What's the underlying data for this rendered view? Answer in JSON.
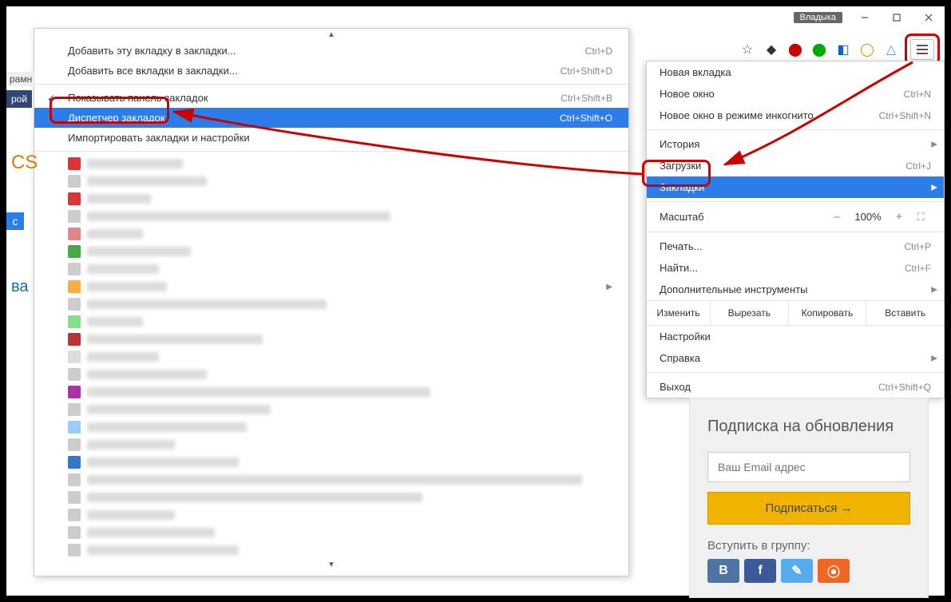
{
  "titlebar": {
    "user": "Владыка"
  },
  "main_menu": {
    "new_tab": "Новая вкладка",
    "new_window": "Новое окно",
    "new_window_sc": "Ctrl+N",
    "incognito": "Новое окно в режиме инкогнито",
    "incognito_sc": "Ctrl+Shift+N",
    "history": "История",
    "downloads": "Загрузки",
    "downloads_sc": "Ctrl+J",
    "bookmarks": "Закладки",
    "zoom_label": "Масштаб",
    "zoom_val": "100%",
    "print": "Печать...",
    "print_sc": "Ctrl+P",
    "find": "Найти...",
    "find_sc": "Ctrl+F",
    "more_tools": "Дополнительные инструменты",
    "edit": "Изменить",
    "cut": "Вырезать",
    "copy": "Копировать",
    "paste": "Вставить",
    "settings": "Настройки",
    "help": "Справка",
    "exit": "Выход",
    "exit_sc": "Ctrl+Shift+Q"
  },
  "sub_menu": {
    "add_tab": "Добавить эту вкладку в закладки...",
    "add_tab_sc": "Ctrl+D",
    "add_all": "Добавить все вкладки в закладки...",
    "add_all_sc": "Ctrl+Shift+D",
    "show_bar": "Показывать панель закладок",
    "show_bar_sc": "Ctrl+Shift+B",
    "manager": "Диспетчер закладок",
    "manager_sc": "Ctrl+Shift+O",
    "import": "Импортировать закладки и настройки"
  },
  "page": {
    "frag1": "рамн",
    "frag2": "рой",
    "cs": "CS",
    "c": "с",
    "va": "ва"
  },
  "subscribe": {
    "title": "Подписка на обновления",
    "placeholder": "Ваш Email адрес",
    "button": "Подписаться →",
    "group_title": "Вступить в группу:"
  }
}
